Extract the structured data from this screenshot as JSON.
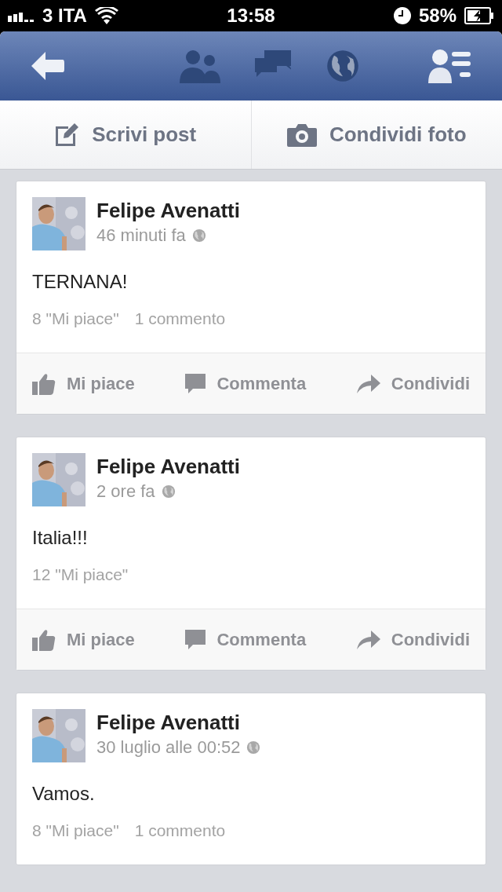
{
  "status_bar": {
    "carrier": "3 ITA",
    "time": "13:58",
    "battery": "58%"
  },
  "composer": [
    {
      "kind": "write",
      "label": "Scrivi post"
    },
    {
      "label": "Condividi foto"
    }
  ],
  "posts": [
    {
      "author": "Felipe Avenatti",
      "time": "46 minuti fa",
      "text": "TERNANA!",
      "likes": "8 \"Mi piace\"",
      "comments": "1 commento",
      "actions": [
        {
          "kind": "like",
          "label": "Mi piace"
        },
        {
          "kind": "comment",
          "label": "Commenta"
        },
        {
          "kind": "share",
          "label": "Condividi"
        }
      ]
    },
    {
      "author": "Felipe Avenatti",
      "time": "2 ore fa",
      "text": "Italia!!!",
      "likes": "12 \"Mi piace\"",
      "actions": [
        {
          "kind": "like",
          "label": "Mi piace"
        },
        {
          "kind": "comment",
          "label": "Commenta"
        },
        {
          "kind": "share",
          "label": "Condividi"
        }
      ]
    },
    {
      "author": "Felipe Avenatti",
      "time": "30 luglio alle 00:52",
      "text": "Vamos.",
      "likes": "8 \"Mi piace\"",
      "comments": "1 commento"
    }
  ]
}
